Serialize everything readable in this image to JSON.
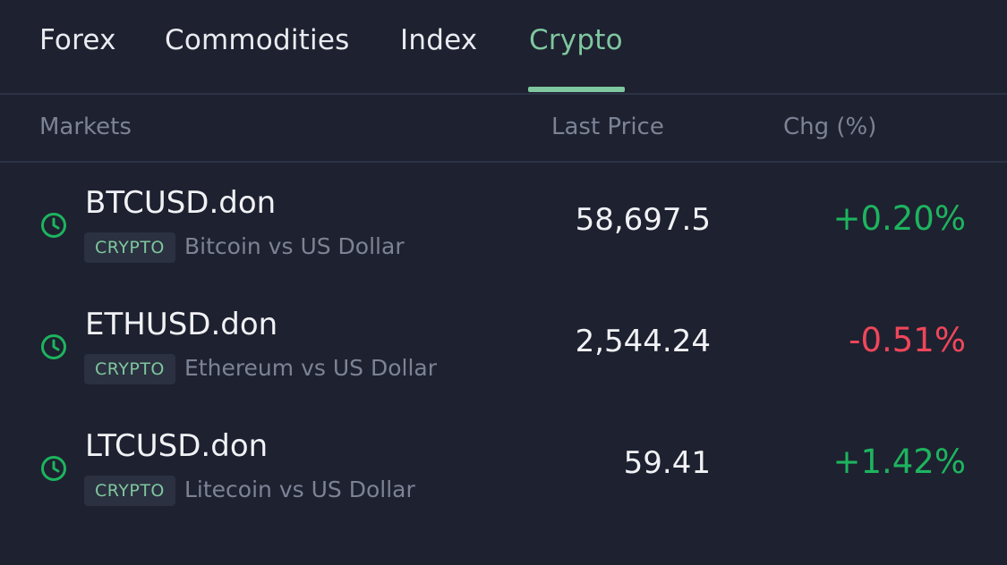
{
  "tabs": [
    {
      "label": "Forex",
      "active": false
    },
    {
      "label": "Commodities",
      "active": false
    },
    {
      "label": "Index",
      "active": false
    },
    {
      "label": "Crypto",
      "active": true
    }
  ],
  "table": {
    "columns": {
      "markets": "Markets",
      "last_price": "Last Price",
      "change": "Chg (%)"
    },
    "rows": [
      {
        "symbol": "BTCUSD.don",
        "tag": "CRYPTO",
        "description": "Bitcoin vs US Dollar",
        "price": "58,697.5",
        "change": "+0.20%",
        "direction": "up",
        "icon": "clock-icon"
      },
      {
        "symbol": "ETHUSD.don",
        "tag": "CRYPTO",
        "description": "Ethereum vs US Dollar",
        "price": "2,544.24",
        "change": "-0.51%",
        "direction": "down",
        "icon": "clock-icon"
      },
      {
        "symbol": "LTCUSD.don",
        "tag": "CRYPTO",
        "description": "Litecoin vs US Dollar",
        "price": "59.41",
        "change": "+1.42%",
        "direction": "up",
        "icon": "clock-icon"
      }
    ]
  },
  "colors": {
    "background": "#1e2130",
    "accent": "#7fc79f",
    "positive": "#1db45e",
    "negative": "#f0465a",
    "muted_text": "#7c8394"
  }
}
